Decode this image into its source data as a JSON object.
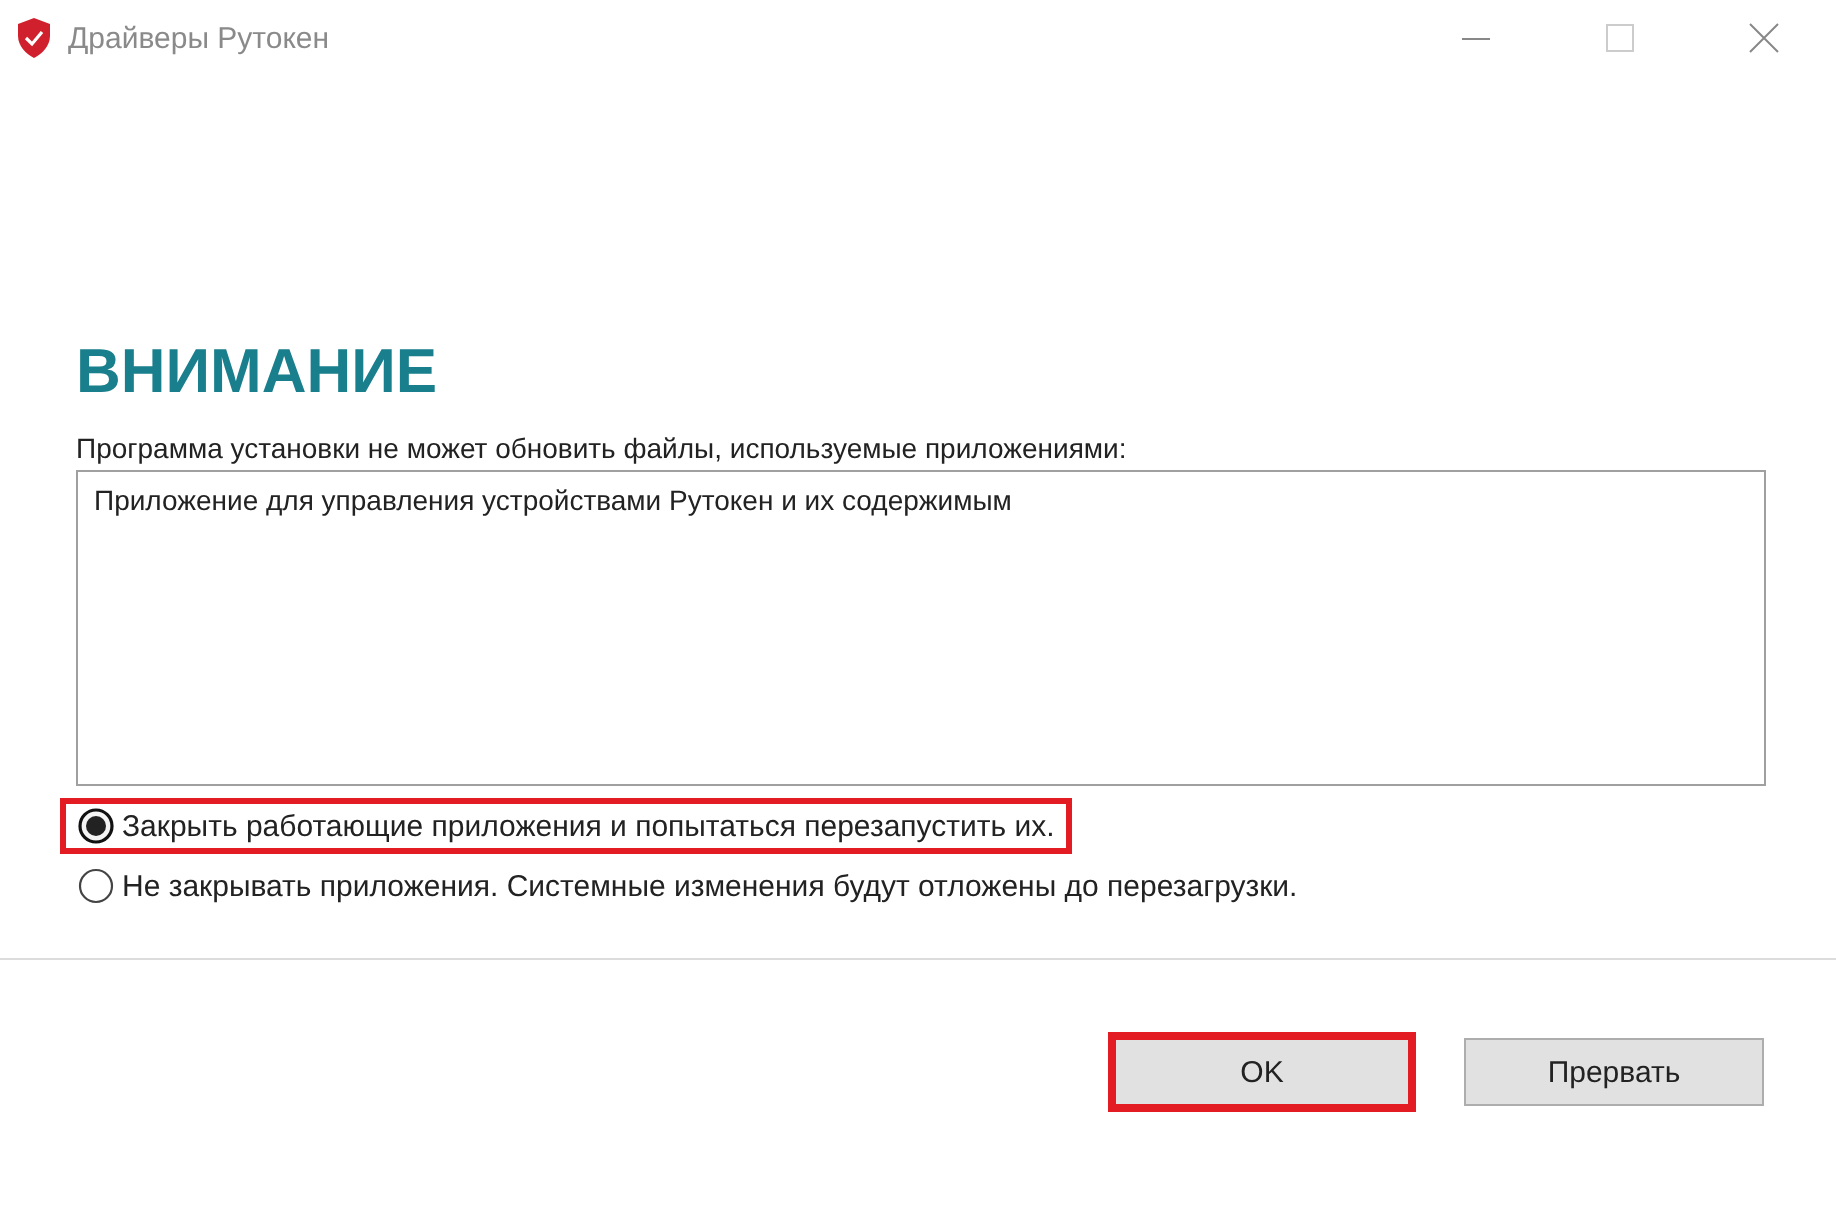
{
  "window": {
    "title": "Драйверы Рутокен"
  },
  "heading": "ВНИМАНИЕ",
  "message": "Программа установки не может обновить файлы, используемые приложениями:",
  "applications": [
    {
      "name": "Приложение для управления устройствами Рутокен и их содержимым"
    }
  ],
  "options": [
    {
      "label": "Закрыть работающие приложения и попытаться перезапустить их.",
      "selected": true,
      "highlighted": true
    },
    {
      "label": "Не закрывать приложения. Системные изменения будут отложены до перезагрузки.",
      "selected": false,
      "highlighted": false
    }
  ],
  "buttons": [
    {
      "label": "OK",
      "highlighted": true
    },
    {
      "label": "Прервать",
      "highlighted": false
    }
  ]
}
